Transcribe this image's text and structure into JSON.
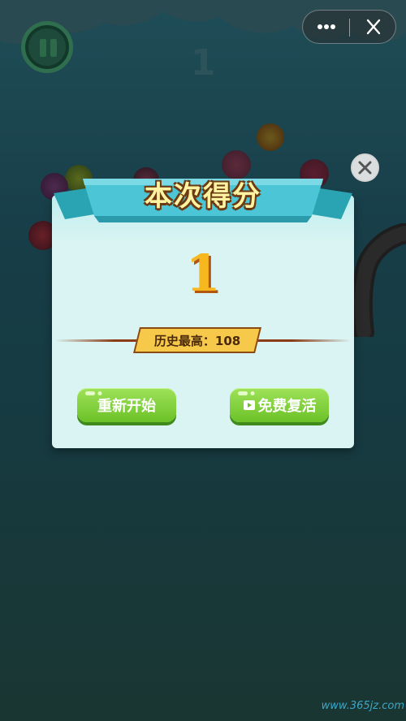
{
  "hud": {
    "current_score": "1"
  },
  "result_panel": {
    "title": "本次得分",
    "score": "1",
    "best_label": "历史最高：108",
    "buttons": {
      "restart": "重新开始",
      "revive": "免费复活"
    }
  },
  "watermark": "www.365jz.com",
  "icons": {
    "pause": "pause-icon",
    "more": "more-dots-icon",
    "close_capsule": "close-icon",
    "close_panel": "close-circle-icon",
    "video": "video-icon"
  },
  "colors": {
    "background": "#1f4d57",
    "panel": "#d9f4f3",
    "ribbon": "#4cc6d7",
    "title_text": "#fff3a2",
    "score_text": "#f6b81e",
    "button": "#7cce33",
    "best_badge": "#f7c94a"
  }
}
